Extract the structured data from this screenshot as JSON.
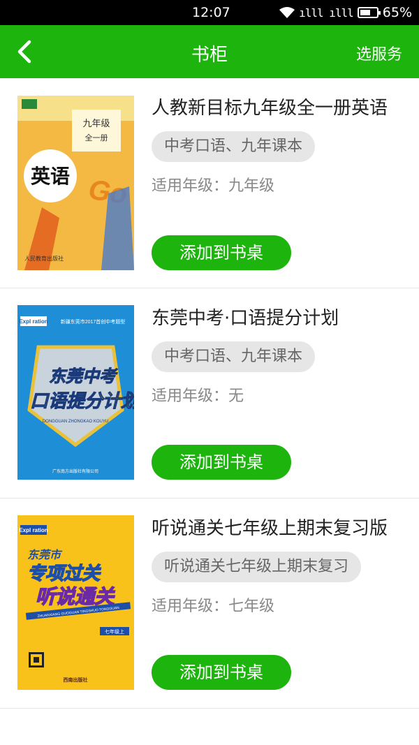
{
  "status_bar": {
    "time": "12:07",
    "signal": "ılll ılll",
    "battery": "65%",
    "battery_level": 0.65
  },
  "header": {
    "back_icon": "chevron-left-icon",
    "title": "书柜",
    "action": "选服务"
  },
  "colors": {
    "brand_green": "#1db40e",
    "tag_bg": "#e6e6e6"
  },
  "books": [
    {
      "title": "人教新目标九年级全一册英语",
      "tag": "中考口语、九年课本",
      "grade": "适用年级：九年级",
      "button": "添加到书桌",
      "cover": {
        "top_label": "九年级",
        "sub_label": "全一册",
        "subject": "英语",
        "slogan": "Go for it!",
        "publisher": "人民教育出版社"
      }
    },
    {
      "title": "东莞中考·口语提分计划",
      "tag": "中考口语、九年课本",
      "grade": "适用年级：无",
      "button": "添加到书桌",
      "cover": {
        "brand": "Expl ration",
        "top_label": "新疆东莞市2017首创中考题型",
        "line1": "东莞中考",
        "line2": "口语提分计划",
        "pinyin": "DONGGUAN ZHONGKAO KOUYU",
        "publisher": "广东南方出版社有限公司"
      }
    },
    {
      "title": "听说通关七年级上期末复习版",
      "tag": "听说通关七年级上期末复习",
      "grade": "适用年级：七年级",
      "button": "添加到书桌",
      "cover": {
        "brand": "Expl ration",
        "line0": "东莞市",
        "line1": "专项过关",
        "line2": "听说通关",
        "pinyin": "ZHUANXIANG GUOGUAN TINGSHUO TONGGUAN",
        "badge": "七年级上",
        "publisher": "西南出版社"
      }
    }
  ]
}
